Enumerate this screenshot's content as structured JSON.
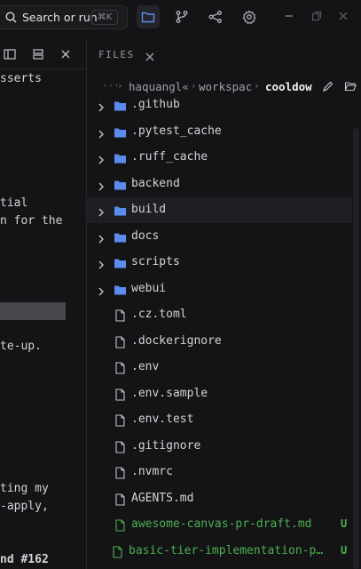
{
  "topbar": {
    "search_label": "Search or run",
    "search_shortcut": "⌘K",
    "icons": [
      "search-icon",
      "folder-icon",
      "git-branch-icon",
      "graph-icon",
      "settings-icon",
      "minimize-icon",
      "maximize-icon",
      "close-icon"
    ]
  },
  "left_panel": {
    "lines": [
      {
        "text": "sserts"
      },
      {
        "text": "tial"
      },
      {
        "text": "n for the"
      },
      {
        "text": "te-up."
      },
      {
        "text": "ting my"
      },
      {
        "text": "-apply,"
      },
      {
        "text": "nd #162"
      }
    ]
  },
  "files_panel": {
    "title": "FILES",
    "breadcrumb": [
      {
        "label": "haquangl«"
      },
      {
        "label": "workspac"
      },
      {
        "label": "cooldow"
      }
    ],
    "items": [
      {
        "name": ".github",
        "type": "folder"
      },
      {
        "name": ".pytest_cache",
        "type": "folder"
      },
      {
        "name": ".ruff_cache",
        "type": "folder"
      },
      {
        "name": "backend",
        "type": "folder"
      },
      {
        "name": "build",
        "type": "folder",
        "selected": true
      },
      {
        "name": "docs",
        "type": "folder"
      },
      {
        "name": "scripts",
        "type": "folder"
      },
      {
        "name": "webui",
        "type": "folder"
      },
      {
        "name": ".cz.toml",
        "type": "file"
      },
      {
        "name": ".dockerignore",
        "type": "file"
      },
      {
        "name": ".env",
        "type": "file"
      },
      {
        "name": ".env.sample",
        "type": "file"
      },
      {
        "name": ".env.test",
        "type": "file"
      },
      {
        "name": ".gitignore",
        "type": "file"
      },
      {
        "name": ".nvmrc",
        "type": "file"
      },
      {
        "name": "AGENTS.md",
        "type": "file"
      },
      {
        "name": "awesome-canvas-pr-draft.md",
        "type": "file",
        "status": "U"
      },
      {
        "name": "basic-tier-implementation-p…",
        "type": "file",
        "status": "U"
      }
    ]
  },
  "colors": {
    "background": "#141416",
    "folder": "#5b8def",
    "untracked": "#4caf50",
    "accent": "#3b82f6"
  }
}
